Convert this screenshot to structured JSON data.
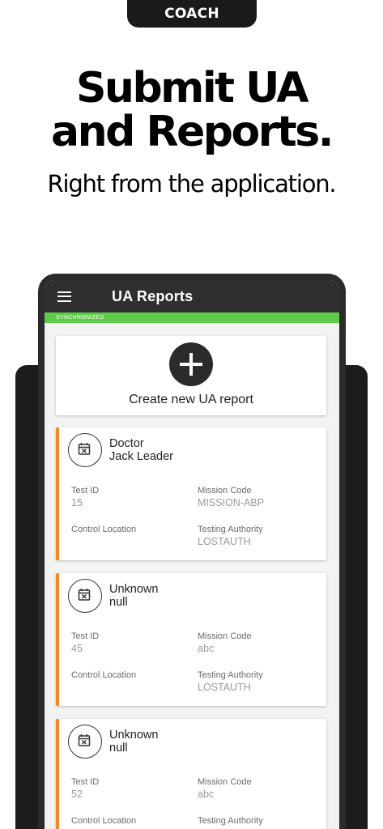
{
  "badge": "COACH",
  "headline": {
    "line1": "Submit UA",
    "line2": "and Reports.",
    "sub": "Right from the application."
  },
  "app": {
    "title": "UA Reports",
    "sync_status": "SYNCHRONIZED",
    "create_label": "Create new UA report"
  },
  "reports": [
    {
      "name_line1": "Doctor",
      "name_line2": "Jack Leader",
      "test_id_label": "Test ID",
      "test_id": "15",
      "mission_code_label": "Mission Code",
      "mission_code": "MISSION-ABP",
      "control_location_label": "Control Location",
      "control_location": "",
      "testing_authority_label": "Testing Authority",
      "testing_authority": "LOSTAUTH"
    },
    {
      "name_line1": "Unknown",
      "name_line2": "null",
      "test_id_label": "Test ID",
      "test_id": "45",
      "mission_code_label": "Mission Code",
      "mission_code": "abc",
      "control_location_label": "Control Location",
      "control_location": "",
      "testing_authority_label": "Testing Authority",
      "testing_authority": "LOSTAUTH"
    },
    {
      "name_line1": "Unknown",
      "name_line2": "null",
      "test_id_label": "Test ID",
      "test_id": "52",
      "mission_code_label": "Mission Code",
      "mission_code": "abc",
      "control_location_label": "Control Location",
      "control_location": "",
      "testing_authority_label": "Testing Authority",
      "testing_authority": ""
    }
  ],
  "colors": {
    "sync_green": "#5fcb4a",
    "accent_orange": "#f08a24",
    "appbar": "#2f2f2f"
  },
  "icons": {
    "menu": "hamburger-menu-icon",
    "create": "plus-icon",
    "report": "calendar-cancel-icon"
  }
}
